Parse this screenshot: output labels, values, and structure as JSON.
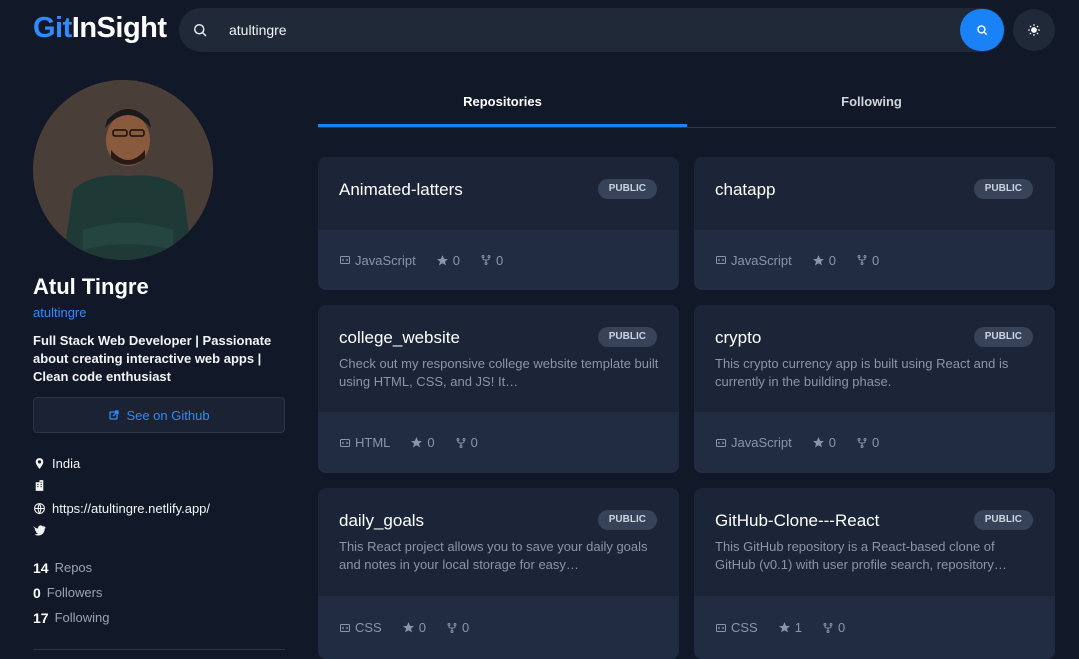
{
  "header": {
    "logo_part1": "Git",
    "logo_part2": "InSight",
    "search_value": "atultingre"
  },
  "profile": {
    "name": "Atul Tingre",
    "username": "atultingre",
    "bio": "Full Stack Web Developer | Passionate about creating interactive web apps | Clean code enthusiast",
    "see_on_github": "See on Github",
    "location": "India",
    "company": "",
    "website": "https://atultingre.netlify.app/",
    "twitter": "",
    "stats": [
      {
        "num": "14",
        "label": "Repos"
      },
      {
        "num": "0",
        "label": "Followers"
      },
      {
        "num": "17",
        "label": "Following"
      }
    ]
  },
  "tabs": [
    {
      "label": "Repositories",
      "active": true
    },
    {
      "label": "Following",
      "active": false
    }
  ],
  "repos": [
    {
      "name": "Animated-latters",
      "visibility": "PUBLIC",
      "description": "",
      "language": "JavaScript",
      "stars": "0",
      "forks": "0"
    },
    {
      "name": "chatapp",
      "visibility": "PUBLIC",
      "description": "",
      "language": "JavaScript",
      "stars": "0",
      "forks": "0"
    },
    {
      "name": "college_website",
      "visibility": "PUBLIC",
      "description": "Check out my responsive college website template built using HTML, CSS, and JS! It…",
      "language": "HTML",
      "stars": "0",
      "forks": "0"
    },
    {
      "name": "crypto",
      "visibility": "PUBLIC",
      "description": "This crypto currency app is built using React and is currently in the building phase.",
      "language": "JavaScript",
      "stars": "0",
      "forks": "0"
    },
    {
      "name": "daily_goals",
      "visibility": "PUBLIC",
      "description": "This React project allows you to save your daily goals and notes in your local storage for easy…",
      "language": "CSS",
      "stars": "0",
      "forks": "0"
    },
    {
      "name": "GitHub-Clone---React",
      "visibility": "PUBLIC",
      "description": "This GitHub repository is a React-based clone of GitHub (v0.1) with user profile search, repository…",
      "language": "CSS",
      "stars": "1",
      "forks": "0"
    }
  ],
  "colors": {
    "accent": "#1a82f7",
    "background": "#111827",
    "card": "#1c2538"
  },
  "icons": {
    "search": "search-icon",
    "theme": "sun-icon",
    "location": "map-pin-icon",
    "company": "building-icon",
    "website": "globe-icon",
    "twitter": "twitter-icon",
    "external": "external-link-icon",
    "star": "star-icon",
    "fork": "fork-icon",
    "code": "code-icon"
  }
}
